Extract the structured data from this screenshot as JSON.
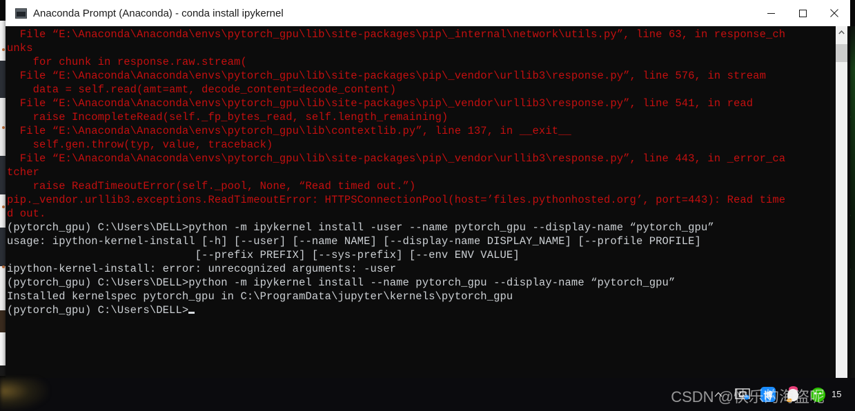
{
  "window": {
    "title": "Anaconda Prompt (Anaconda) - conda  install ipykernel",
    "icon": "console-icon",
    "controls": {
      "minimize": "minimize-button",
      "maximize": "maximize-button",
      "close": "close-button"
    }
  },
  "terminal": {
    "background": "#0c0c0c",
    "error_color": "#c40f0f",
    "output_color": "#ccd0d4",
    "lines": [
      {
        "style": "err",
        "text": "  File “E:\\Anaconda\\Anaconda\\envs\\pytorch_gpu\\lib\\site-packages\\pip\\_internal\\network\\utils.py”, line 63, in response_ch"
      },
      {
        "style": "err",
        "text": "unks"
      },
      {
        "style": "err",
        "text": "    for chunk in response.raw.stream("
      },
      {
        "style": "err",
        "text": "  File “E:\\Anaconda\\Anaconda\\envs\\pytorch_gpu\\lib\\site-packages\\pip\\_vendor\\urllib3\\response.py”, line 576, in stream"
      },
      {
        "style": "err",
        "text": "    data = self.read(amt=amt, decode_content=decode_content)"
      },
      {
        "style": "err",
        "text": "  File “E:\\Anaconda\\Anaconda\\envs\\pytorch_gpu\\lib\\site-packages\\pip\\_vendor\\urllib3\\response.py”, line 541, in read"
      },
      {
        "style": "err",
        "text": "    raise IncompleteRead(self._fp_bytes_read, self.length_remaining)"
      },
      {
        "style": "err",
        "text": "  File “E:\\Anaconda\\Anaconda\\envs\\pytorch_gpu\\lib\\contextlib.py”, line 137, in __exit__"
      },
      {
        "style": "err",
        "text": "    self.gen.throw(typ, value, traceback)"
      },
      {
        "style": "err",
        "text": "  File “E:\\Anaconda\\Anaconda\\envs\\pytorch_gpu\\lib\\site-packages\\pip\\_vendor\\urllib3\\response.py”, line 443, in _error_ca"
      },
      {
        "style": "err",
        "text": "tcher"
      },
      {
        "style": "err",
        "text": "    raise ReadTimeoutError(self._pool, None, “Read timed out.”)"
      },
      {
        "style": "err",
        "text": "pip._vendor.urllib3.exceptions.ReadTimeoutError: HTTPSConnectionPool(host=’files.pythonhosted.org’, port=443): Read time"
      },
      {
        "style": "err",
        "text": "d out."
      },
      {
        "style": "out",
        "text": ""
      },
      {
        "style": "out",
        "text": "(pytorch_gpu) C:\\Users\\DELL>python -m ipykernel install -user --name pytorch_gpu --display-name “pytorch_gpu”"
      },
      {
        "style": "out",
        "text": "usage: ipython-kernel-install [-h] [--user] [--name NAME] [--display-name DISPLAY_NAME] [--profile PROFILE]"
      },
      {
        "style": "out",
        "text": "                             [--prefix PREFIX] [--sys-prefix] [--env ENV VALUE]"
      },
      {
        "style": "out",
        "text": "ipython-kernel-install: error: unrecognized arguments: -user"
      },
      {
        "style": "out",
        "text": ""
      },
      {
        "style": "out",
        "text": "(pytorch_gpu) C:\\Users\\DELL>python -m ipykernel install --name pytorch_gpu --display-name “pytorch_gpu”"
      },
      {
        "style": "out",
        "text": "Installed kernelspec pytorch_gpu in C:\\ProgramData\\jupyter\\kernels\\pytorch_gpu"
      },
      {
        "style": "out",
        "text": ""
      },
      {
        "style": "out",
        "text": "(pytorch_gpu) C:\\Users\\DELL>",
        "cursor": true
      }
    ]
  },
  "scrollbar": {
    "up_arrow": "scroll-up-arrow-icon",
    "thumb": "scrollbar-thumb"
  },
  "taskbar": {
    "tray": [
      {
        "name": "show-hidden-icons-chevron-icon",
        "glyph": "∧"
      },
      {
        "name": "onedrive-icon"
      },
      {
        "name": "mi-app-icon",
        "glyph": "博"
      },
      {
        "name": "qq-icon"
      },
      {
        "name": "wechat-icon"
      }
    ],
    "clock": "15"
  },
  "watermark": {
    "text": "CSDN @快乐的海盗呢"
  },
  "background": {
    "right_panel_text": [
      "|",
      "~",
      "$",
      ">",
      "#",
      "%",
      "|",
      "~",
      "*",
      ">",
      "#",
      "$",
      "|",
      "~",
      ">",
      "#",
      "%",
      "|",
      "~",
      "$",
      ">",
      "#",
      "%",
      "|",
      "~",
      "*",
      ">",
      "#",
      "$",
      "|",
      "~",
      ">",
      "#"
    ]
  }
}
